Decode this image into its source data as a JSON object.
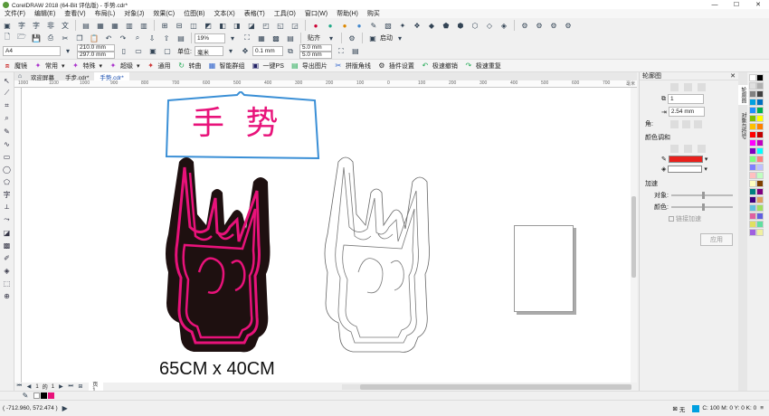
{
  "title": "CorelDRAW 2018 (64-Bit 评估版) - 手势.cdr*",
  "menu": [
    "文件(F)",
    "编辑(E)",
    "查看(V)",
    "布局(L)",
    "对象(J)",
    "效果(C)",
    "位图(B)",
    "文本(X)",
    "表格(T)",
    "工具(O)",
    "窗口(W)",
    "帮助(H)",
    "购买"
  ],
  "toolbar": {
    "zoom": "19%",
    "snap": "贴齐",
    "launch": "启动"
  },
  "props": {
    "page_size": "A4",
    "width": "210.0 mm",
    "height": "297.0 mm",
    "units": "毫米",
    "nudge": "0.1 mm",
    "dup_x": "5.0 mm",
    "dup_y": "5.0 mm"
  },
  "plugins": [
    "魔镜",
    "常用",
    "特殊",
    "超级",
    "通用",
    "转曲",
    "智能群组",
    "一键PS",
    "导出图片",
    "拼版角线",
    "插件设置",
    "极速撤销",
    "极速重复"
  ],
  "tabs": [
    "欢迎屏幕",
    "手步.cdr*",
    "手势.cdr*"
  ],
  "ruler": {
    "h": [
      "1000",
      "1100",
      "1000",
      "900",
      "800",
      "700",
      "600",
      "500",
      "400",
      "300",
      "200",
      "100",
      "0",
      "100",
      "200",
      "300",
      "400",
      "500",
      "600",
      "700"
    ],
    "unit": "毫米"
  },
  "canvas": {
    "sign_text": "手 势",
    "caption": "65CM x 40CM"
  },
  "pager": {
    "current": "1",
    "of": "的",
    "total": "1",
    "page_label": "页1"
  },
  "panel": {
    "title": "轮廓图",
    "steps": "1",
    "offset": "2.54 mm",
    "corner_label": "角:",
    "color_label": "颜色调和",
    "accel_label": "加速",
    "object_label": "对象:",
    "color_label2": "颜色:",
    "apply_label": "链接加速",
    "apply_button": "应用",
    "fill_color": "#e8201c"
  },
  "side_tabs": [
    "轮廓图",
    "对象与符号"
  ],
  "status": {
    "coords": "( -712.960, 572.474 )",
    "fill_none": "无",
    "color_info": "C: 100 M: 0 Y: 0 K: 0"
  },
  "colors": {
    "accent": "#e8127a",
    "sign_fill": "#1e1010",
    "bubble": "#3a8fd6"
  },
  "palette": [
    "#ffffff",
    "#000000",
    "#e0e0e0",
    "#b0b0b0",
    "#808080",
    "#404040",
    "#00a0e0",
    "#0070c0",
    "#1e90ff",
    "#00b050",
    "#7fc000",
    "#ffff00",
    "#ffc000",
    "#ff8000",
    "#ff0000",
    "#c00000",
    "#ff00ff",
    "#c000c0",
    "#8000c0",
    "#00ffff",
    "#80ff80",
    "#ff8080",
    "#8080ff",
    "#c0c0ff",
    "#ffc0c0",
    "#c0ffc0",
    "#ffffc0",
    "#804000",
    "#008080",
    "#800080",
    "#400080",
    "#e0a060",
    "#60c0e0",
    "#a0e060",
    "#e060a0",
    "#6060e0",
    "#e0e060",
    "#60e0a0",
    "#a060e0",
    "#f0f0a0"
  ]
}
